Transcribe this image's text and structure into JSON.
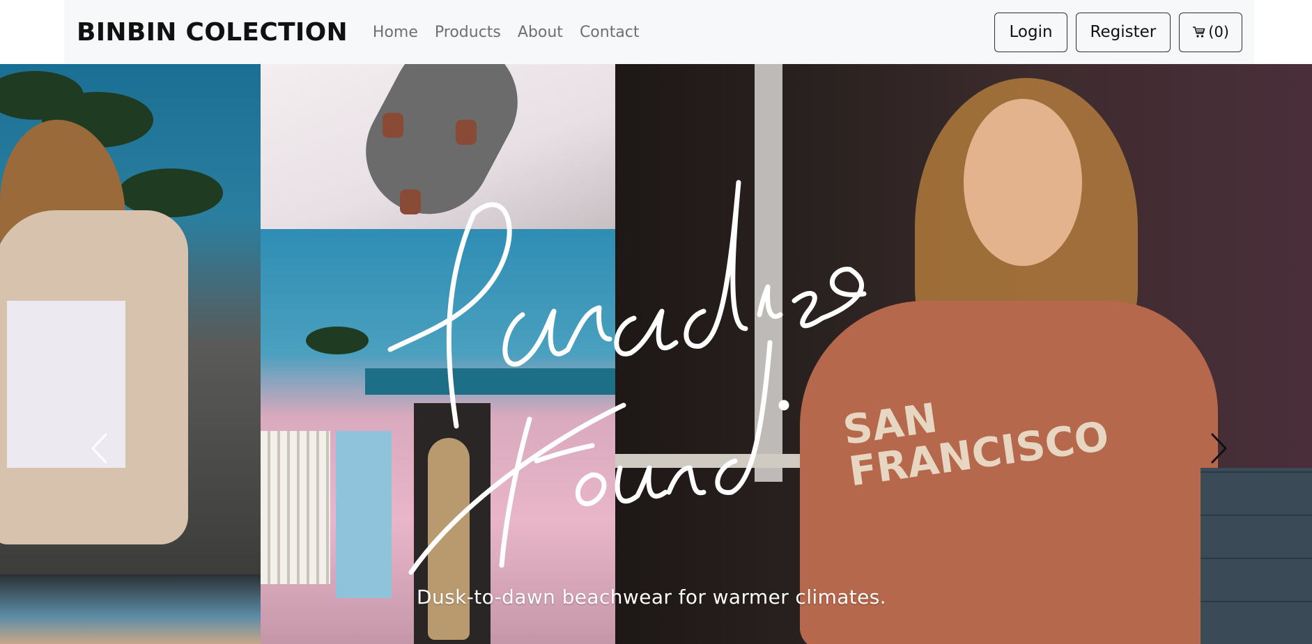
{
  "navbar": {
    "brand": "BINBIN COLECTION",
    "links": [
      "Home",
      "Products",
      "About",
      "Contact"
    ],
    "login_label": "Login",
    "register_label": "Register",
    "cart_label": "(0)",
    "cart_icon": "cart-icon",
    "background": "#f7f8fa"
  },
  "hero": {
    "headline": "Paradise Found.",
    "tagline": "Dusk-to-dawn beachwear for warmer climates.",
    "prev_icon": "chevron-left-icon",
    "next_icon": "chevron-right-icon",
    "images": [
      "woman-in-hoodie-back",
      "skateboard",
      "pink-house-with-model",
      "woman-in-san-francisco-sweatshirt"
    ]
  }
}
